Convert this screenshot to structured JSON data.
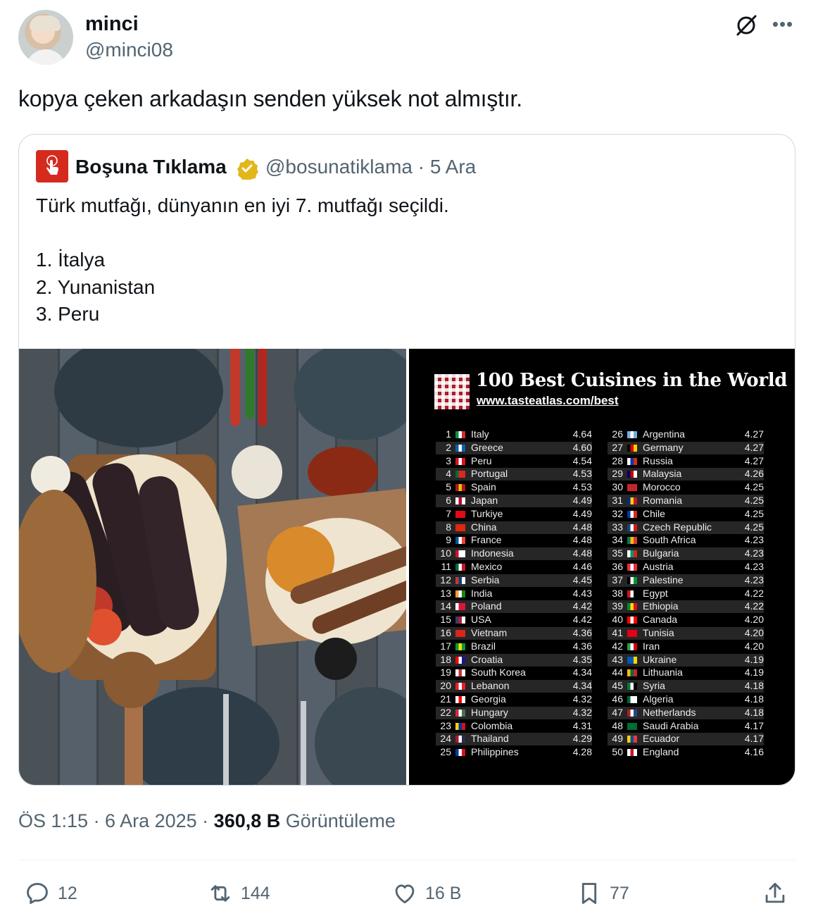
{
  "author": {
    "name": "minci",
    "handle": "@minci08"
  },
  "tweet": {
    "text": "kopya çeken arkadaşın senden yüksek not almıştır."
  },
  "quote": {
    "name": "Boşuna Tıklama",
    "handle_date": "@bosunatiklama · 5 Ara",
    "lines": [
      "Türk mutfağı, dünyanın en iyi 7. mutfağı seçildi.",
      "",
      "1. İtalya",
      "2. Yunanistan",
      "3. Peru"
    ],
    "chart": {
      "title": "100 Best Cuisines in the World",
      "url": "www.tasteatlas.com/best",
      "left": [
        {
          "r": "1",
          "c": "Italy",
          "s": "4.64",
          "f": [
            "#009246",
            "#fff",
            "#ce2b37"
          ]
        },
        {
          "r": "2",
          "c": "Greece",
          "s": "4.60",
          "f": [
            "#0d5eaf",
            "#fff",
            "#0d5eaf"
          ]
        },
        {
          "r": "3",
          "c": "Peru",
          "s": "4.54",
          "f": [
            "#d91023",
            "#fff",
            "#d91023"
          ]
        },
        {
          "r": "4",
          "c": "Portugal",
          "s": "4.53",
          "f": [
            "#046a38",
            "#da291c",
            "#da291c"
          ]
        },
        {
          "r": "5",
          "c": "Spain",
          "s": "4.53",
          "f": [
            "#aa151b",
            "#f1bf00",
            "#aa151b"
          ]
        },
        {
          "r": "6",
          "c": "Japan",
          "s": "4.49",
          "f": [
            "#fff",
            "#bc002d",
            "#fff"
          ]
        },
        {
          "r": "7",
          "c": "Turkiye",
          "s": "4.49",
          "f": [
            "#e30a17",
            "#e30a17",
            "#e30a17"
          ]
        },
        {
          "r": "8",
          "c": "China",
          "s": "4.48",
          "f": [
            "#de2910",
            "#de2910",
            "#de2910"
          ]
        },
        {
          "r": "9",
          "c": "France",
          "s": "4.48",
          "f": [
            "#0055a4",
            "#fff",
            "#ef4135"
          ]
        },
        {
          "r": "10",
          "c": "Indonesia",
          "s": "4.48",
          "f": [
            "#ce1126",
            "#fff",
            "#fff"
          ]
        },
        {
          "r": "11",
          "c": "Mexico",
          "s": "4.46",
          "f": [
            "#006847",
            "#fff",
            "#ce1126"
          ]
        },
        {
          "r": "12",
          "c": "Serbia",
          "s": "4.45",
          "f": [
            "#c6363c",
            "#0c4076",
            "#fff"
          ]
        },
        {
          "r": "13",
          "c": "India",
          "s": "4.43",
          "f": [
            "#ff9933",
            "#fff",
            "#138808"
          ]
        },
        {
          "r": "14",
          "c": "Poland",
          "s": "4.42",
          "f": [
            "#fff",
            "#dc143c",
            "#dc143c"
          ]
        },
        {
          "r": "15",
          "c": "USA",
          "s": "4.42",
          "f": [
            "#3c3b6e",
            "#b22234",
            "#fff"
          ]
        },
        {
          "r": "16",
          "c": "Vietnam",
          "s": "4.36",
          "f": [
            "#da251d",
            "#da251d",
            "#da251d"
          ]
        },
        {
          "r": "17",
          "c": "Brazil",
          "s": "4.36",
          "f": [
            "#009c3b",
            "#ffdf00",
            "#009c3b"
          ]
        },
        {
          "r": "18",
          "c": "Croatia",
          "s": "4.35",
          "f": [
            "#ff0000",
            "#fff",
            "#171796"
          ]
        },
        {
          "r": "19",
          "c": "South Korea",
          "s": "4.34",
          "f": [
            "#fff",
            "#cd2e3a",
            "#fff"
          ]
        },
        {
          "r": "20",
          "c": "Lebanon",
          "s": "4.34",
          "f": [
            "#ed1c24",
            "#fff",
            "#ed1c24"
          ]
        },
        {
          "r": "21",
          "c": "Georgia",
          "s": "4.32",
          "f": [
            "#fff",
            "#ff0000",
            "#fff"
          ]
        },
        {
          "r": "22",
          "c": "Hungary",
          "s": "4.32",
          "f": [
            "#ce2939",
            "#fff",
            "#477050"
          ]
        },
        {
          "r": "23",
          "c": "Colombia",
          "s": "4.31",
          "f": [
            "#fcd116",
            "#003893",
            "#ce1126"
          ]
        },
        {
          "r": "24",
          "c": "Thailand",
          "s": "4.29",
          "f": [
            "#a51931",
            "#fff",
            "#2d2a4a"
          ]
        },
        {
          "r": "25",
          "c": "Philippines",
          "s": "4.28",
          "f": [
            "#0038a8",
            "#fff",
            "#ce1126"
          ]
        }
      ],
      "right": [
        {
          "r": "26",
          "c": "Argentina",
          "s": "4.27",
          "f": [
            "#74acdf",
            "#fff",
            "#74acdf"
          ]
        },
        {
          "r": "27",
          "c": "Germany",
          "s": "4.27",
          "f": [
            "#000",
            "#dd0000",
            "#ffce00"
          ]
        },
        {
          "r": "28",
          "c": "Russia",
          "s": "4.27",
          "f": [
            "#fff",
            "#0039a6",
            "#d52b1e"
          ]
        },
        {
          "r": "29",
          "c": "Malaysia",
          "s": "4.26",
          "f": [
            "#010066",
            "#cc0001",
            "#fff"
          ]
        },
        {
          "r": "30",
          "c": "Morocco",
          "s": "4.25",
          "f": [
            "#c1272d",
            "#c1272d",
            "#c1272d"
          ]
        },
        {
          "r": "31",
          "c": "Romania",
          "s": "4.25",
          "f": [
            "#002b7f",
            "#fcd116",
            "#ce1126"
          ]
        },
        {
          "r": "32",
          "c": "Chile",
          "s": "4.25",
          "f": [
            "#0039a6",
            "#fff",
            "#d52b1e"
          ]
        },
        {
          "r": "33",
          "c": "Czech Republic",
          "s": "4.25",
          "f": [
            "#11457e",
            "#fff",
            "#d7141a"
          ]
        },
        {
          "r": "34",
          "c": "South Africa",
          "s": "4.23",
          "f": [
            "#007a4d",
            "#ffb612",
            "#de3831"
          ]
        },
        {
          "r": "35",
          "c": "Bulgaria",
          "s": "4.23",
          "f": [
            "#fff",
            "#00966e",
            "#d62612"
          ]
        },
        {
          "r": "36",
          "c": "Austria",
          "s": "4.23",
          "f": [
            "#ed2939",
            "#fff",
            "#ed2939"
          ]
        },
        {
          "r": "37",
          "c": "Palestine",
          "s": "4.23",
          "f": [
            "#000",
            "#fff",
            "#009736"
          ]
        },
        {
          "r": "38",
          "c": "Egypt",
          "s": "4.22",
          "f": [
            "#ce1126",
            "#fff",
            "#000"
          ]
        },
        {
          "r": "39",
          "c": "Ethiopia",
          "s": "4.22",
          "f": [
            "#078930",
            "#fcdd09",
            "#da121a"
          ]
        },
        {
          "r": "40",
          "c": "Canada",
          "s": "4.20",
          "f": [
            "#ff0000",
            "#fff",
            "#ff0000"
          ]
        },
        {
          "r": "41",
          "c": "Tunisia",
          "s": "4.20",
          "f": [
            "#e70013",
            "#e70013",
            "#e70013"
          ]
        },
        {
          "r": "42",
          "c": "Iran",
          "s": "4.20",
          "f": [
            "#239f40",
            "#fff",
            "#da0000"
          ]
        },
        {
          "r": "43",
          "c": "Ukraine",
          "s": "4.19",
          "f": [
            "#0057b7",
            "#0057b7",
            "#ffd700"
          ]
        },
        {
          "r": "44",
          "c": "Lithuania",
          "s": "4.19",
          "f": [
            "#fdb913",
            "#006a44",
            "#c1272d"
          ]
        },
        {
          "r": "45",
          "c": "Syria",
          "s": "4.18",
          "f": [
            "#007a3d",
            "#fff",
            "#000"
          ]
        },
        {
          "r": "46",
          "c": "Algeria",
          "s": "4.18",
          "f": [
            "#006233",
            "#fff",
            "#fff"
          ]
        },
        {
          "r": "47",
          "c": "Netherlands",
          "s": "4.18",
          "f": [
            "#ae1c28",
            "#fff",
            "#21468b"
          ]
        },
        {
          "r": "48",
          "c": "Saudi Arabia",
          "s": "4.17",
          "f": [
            "#006c35",
            "#006c35",
            "#006c35"
          ]
        },
        {
          "r": "49",
          "c": "Ecuador",
          "s": "4.17",
          "f": [
            "#ffd100",
            "#034ea2",
            "#ef3340"
          ]
        },
        {
          "r": "50",
          "c": "England",
          "s": "4.16",
          "f": [
            "#fff",
            "#ce1124",
            "#fff"
          ]
        }
      ]
    }
  },
  "meta": {
    "time_date": "ÖS 1:15 · 6 Ara 2025 · ",
    "views": "360,8 B",
    "views_label": " Görüntüleme"
  },
  "actions": {
    "replies": "12",
    "reposts": "144",
    "likes": "16 B",
    "bookmarks": "77"
  },
  "colors": {
    "secondary": "#536471",
    "border": "#cfd9de",
    "verified": "#e2b719"
  }
}
